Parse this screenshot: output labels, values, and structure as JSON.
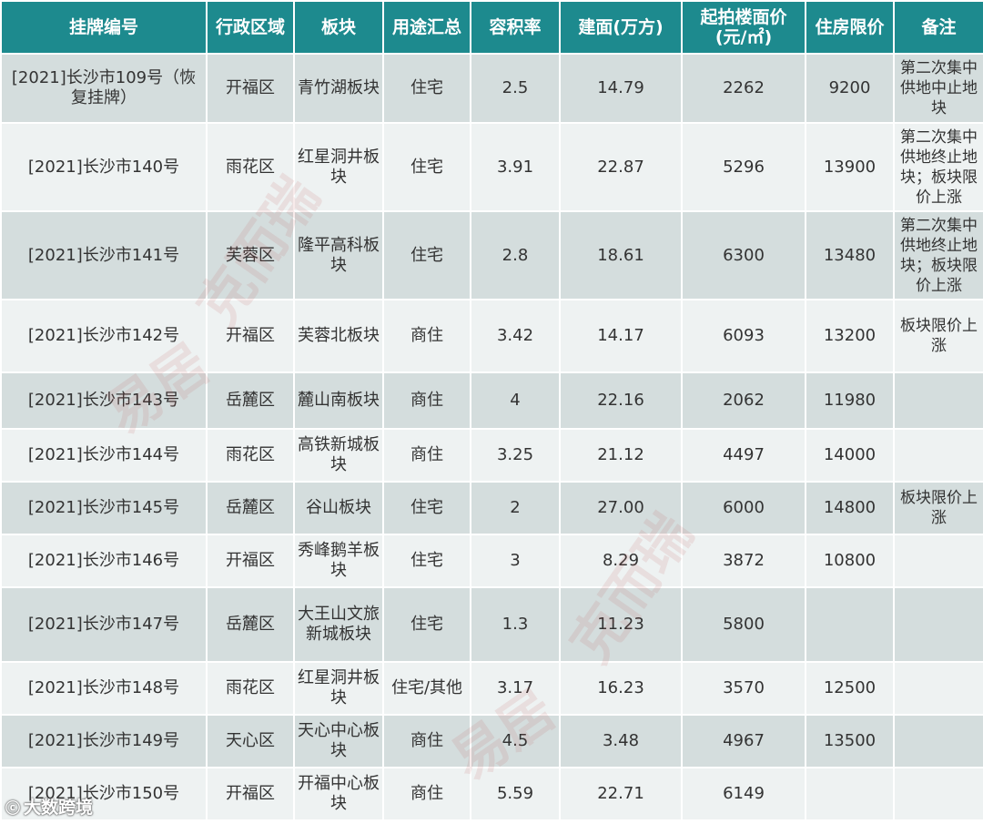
{
  "headers": [
    "挂牌编号",
    "行政区域",
    "板块",
    "用途汇总",
    "容积率",
    "建面(万方)",
    "起拍楼面价\n(元/㎡)",
    "住房限价",
    "备注"
  ],
  "rows": [
    [
      "[2021]长沙市109号（恢复挂牌）",
      "开福区",
      "青竹湖板块",
      "住宅",
      "2.5",
      "14.79",
      "2262",
      "9200",
      "第二次集中供地中止地块"
    ],
    [
      "[2021]长沙市140号",
      "雨花区",
      "红星洞井板块",
      "住宅",
      "3.91",
      "22.87",
      "5296",
      "13900",
      "第二次集中供地终止地块；板块限价上涨"
    ],
    [
      "[2021]长沙市141号",
      "芙蓉区",
      "隆平高科板块",
      "住宅",
      "2.8",
      "18.61",
      "6300",
      "13480",
      "第二次集中供地终止地块；板块限价上涨"
    ],
    [
      "[2021]长沙市142号",
      "开福区",
      "芙蓉北板块",
      "商住",
      "3.42",
      "14.17",
      "6093",
      "13200",
      "板块限价上涨"
    ],
    [
      "[2021]长沙市143号",
      "岳麓区",
      "麓山南板块",
      "商住",
      "4",
      "22.16",
      "2062",
      "11980",
      ""
    ],
    [
      "[2021]长沙市144号",
      "雨花区",
      "高铁新城板块",
      "商住",
      "3.25",
      "21.12",
      "4497",
      "14000",
      ""
    ],
    [
      "[2021]长沙市145号",
      "岳麓区",
      "谷山板块",
      "住宅",
      "2",
      "27.00",
      "6000",
      "14800",
      "板块限价上涨"
    ],
    [
      "[2021]长沙市146号",
      "开福区",
      "秀峰鹅羊板块",
      "住宅",
      "3",
      "8.29",
      "3872",
      "10800",
      ""
    ],
    [
      "[2021]长沙市147号",
      "岳麓区",
      "大王山文旅新城板块",
      "住宅",
      "1.3",
      "11.23",
      "5800",
      "",
      ""
    ],
    [
      "[2021]长沙市148号",
      "雨花区",
      "红星洞井板块",
      "住宅/其他",
      "3.17",
      "16.23",
      "3570",
      "12500",
      ""
    ],
    [
      "[2021]长沙市149号",
      "天心区",
      "天心中心板块",
      "商住",
      "4.5",
      "3.48",
      "4967",
      "13500",
      ""
    ],
    [
      "[2021]长沙市150号",
      "开福区",
      "开福中心板块",
      "商住",
      "5.59",
      "22.71",
      "6149",
      "",
      ""
    ]
  ],
  "watermark": {
    "text": "克而瑞",
    "seal": "易居"
  },
  "brand": {
    "logo": "ⓒ",
    "text": "大数跨境"
  },
  "colors": {
    "header_bg": "#1d8a8e",
    "row_dark": "#d4dddd",
    "row_light": "#eef2f2"
  }
}
